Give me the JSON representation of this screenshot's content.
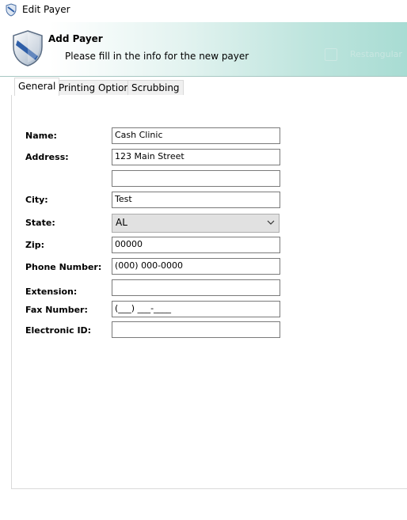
{
  "window": {
    "title": "Edit Payer"
  },
  "banner": {
    "title": "Add Payer",
    "subtitle": "Please fill in the info for the new payer",
    "ghost_text": "Restangular"
  },
  "tabs": [
    {
      "label": "General",
      "active": true
    },
    {
      "label": "Printing Options",
      "active": false
    },
    {
      "label": "Scrubbing",
      "active": false
    }
  ],
  "form": {
    "name": {
      "label": "Name:",
      "value": "Cash Clinic"
    },
    "address": {
      "label": "Address:",
      "value": "123 Main Street"
    },
    "address2": {
      "value": ""
    },
    "city": {
      "label": "City:",
      "value": "Test"
    },
    "state": {
      "label": "State:",
      "value": "AL"
    },
    "zip": {
      "label": "Zip:",
      "value": "00000"
    },
    "phone": {
      "label": "Phone Number:",
      "value": "(000) 000-0000"
    },
    "extension": {
      "label": "Extension:",
      "value": ""
    },
    "fax": {
      "label": "Fax Number:",
      "value": "(___) ___-____"
    },
    "electronic_id": {
      "label": "Electronic ID:",
      "value": ""
    }
  },
  "colors": {
    "banner_accent": "#a8dcd3",
    "shield_blue": "#2f5fa8"
  },
  "icons": [
    "shield-icon",
    "chevron-down-icon"
  ]
}
